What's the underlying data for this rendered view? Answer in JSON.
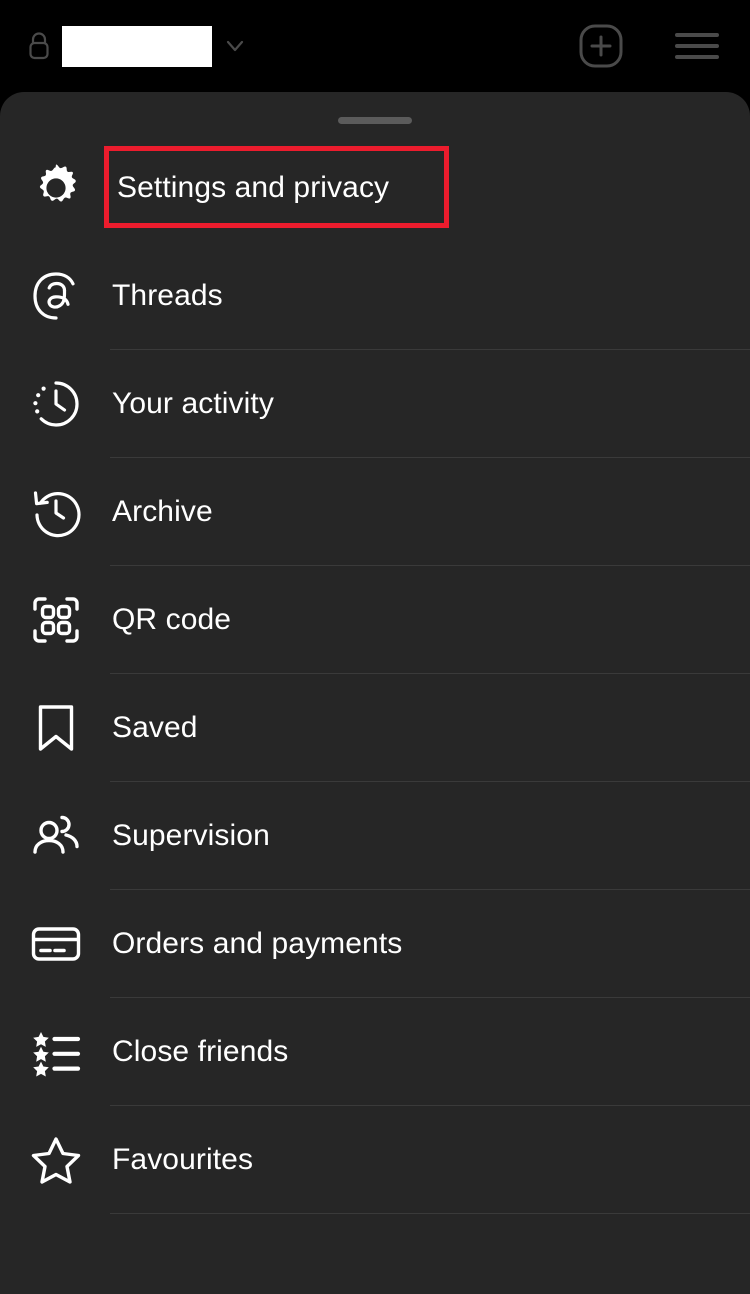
{
  "app": {
    "theme_bg": "#000000",
    "sheet_bg": "#262626",
    "accent_highlight": "#ec1c2d",
    "text_color": "#ffffff"
  },
  "topbar": {
    "lock_icon": "lock-icon",
    "username_value": "",
    "username_redacted": true,
    "chevron_icon": "chevron-down-icon",
    "new_post_icon": "plus-square-icon",
    "menu_icon": "hamburger-menu-icon"
  },
  "sheet": {
    "drag_handle": "drag-handle",
    "highlighted_item_index": 0,
    "items": [
      {
        "label": "Settings and privacy",
        "icon": "gear-icon",
        "name": "settings-and-privacy",
        "highlighted": true
      },
      {
        "label": "Threads",
        "icon": "threads-icon",
        "name": "threads"
      },
      {
        "label": "Your activity",
        "icon": "activity-clock-icon",
        "name": "your-activity"
      },
      {
        "label": "Archive",
        "icon": "archive-clock-icon",
        "name": "archive"
      },
      {
        "label": "QR code",
        "icon": "qr-code-icon",
        "name": "qr-code"
      },
      {
        "label": "Saved",
        "icon": "bookmark-icon",
        "name": "saved"
      },
      {
        "label": "Supervision",
        "icon": "people-icon",
        "name": "supervision"
      },
      {
        "label": "Orders and payments",
        "icon": "credit-card-icon",
        "name": "orders-and-payments"
      },
      {
        "label": "Close friends",
        "icon": "star-list-icon",
        "name": "close-friends"
      },
      {
        "label": "Favourites",
        "icon": "star-outline-icon",
        "name": "favourites"
      }
    ]
  }
}
